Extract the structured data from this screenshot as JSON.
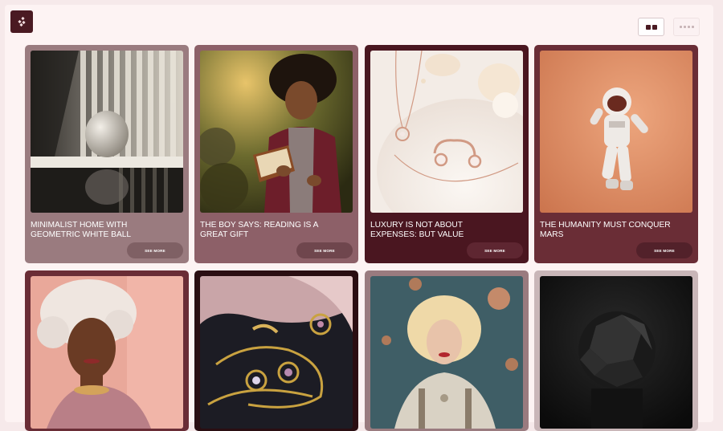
{
  "app": {
    "logo_icon": "sparkle-dots-icon"
  },
  "view_toggle": {
    "active_icon": "grid-two-column-icon",
    "inactive_icon": "grid-four-column-icon"
  },
  "cards": [
    {
      "title": "MINIMALIST HOME WITH GEOMETRIC WHITE BALL",
      "button": "SEE MORE",
      "bg": "#9a7b7f",
      "btn_bg": "#7f6064"
    },
    {
      "title": "THE BOY SAYS: READING IS A GREAT GIFT",
      "button": "SEE MORE",
      "bg": "#8d6068",
      "btn_bg": "#6f464d"
    },
    {
      "title": "LUXURY IS NOT ABOUT EXPENSES: BUT VALUE",
      "button": "SEE MORE",
      "bg": "#4a1620",
      "btn_bg": "#5e2631"
    },
    {
      "title": "THE HUMANITY MUST CONQUER MARS",
      "button": "SEE MORE",
      "bg": "#6a2d36",
      "btn_bg": "#52212a"
    },
    {
      "title": "",
      "button": "",
      "bg": "#6a2d36",
      "btn_bg": "#52212a"
    },
    {
      "title": "",
      "button": "",
      "bg": "#2a0e12",
      "btn_bg": "#3a161c"
    },
    {
      "title": "",
      "button": "",
      "bg": "#9a7b7f",
      "btn_bg": "#7f6064"
    },
    {
      "title": "",
      "button": "",
      "bg": "#c9b6b8",
      "btn_bg": "#a8989a"
    }
  ]
}
